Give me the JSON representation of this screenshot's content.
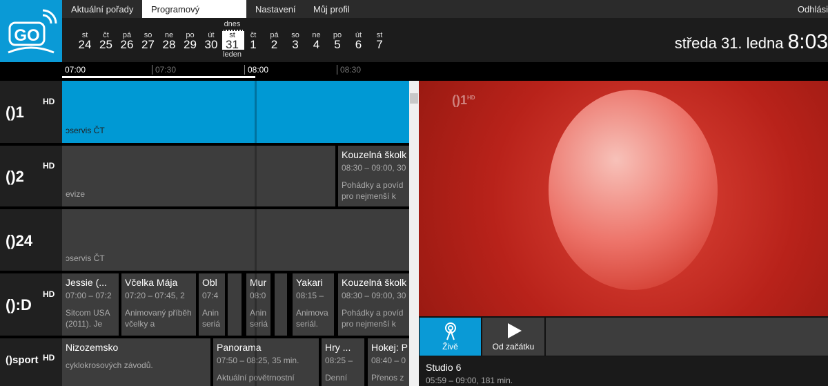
{
  "nav": {
    "tabs": [
      "Aktuální pořady",
      "Programový průvodce",
      "Nastavení",
      "Můj profil"
    ],
    "active": 1,
    "logout": "Odhlási"
  },
  "logo": "GO",
  "dates": [
    {
      "d": "st",
      "n": "24"
    },
    {
      "d": "čt",
      "n": "25"
    },
    {
      "d": "pá",
      "n": "26"
    },
    {
      "d": "so",
      "n": "27"
    },
    {
      "d": "ne",
      "n": "28"
    },
    {
      "d": "po",
      "n": "29"
    },
    {
      "d": "út",
      "n": "30"
    },
    {
      "d": "st",
      "n": "31",
      "top": "dnes",
      "bot": "leden"
    },
    {
      "d": "čt",
      "n": "1"
    },
    {
      "d": "pá",
      "n": "2"
    },
    {
      "d": "so",
      "n": "3"
    },
    {
      "d": "ne",
      "n": "4"
    },
    {
      "d": "po",
      "n": "5"
    },
    {
      "d": "út",
      "n": "6"
    },
    {
      "d": "st",
      "n": "7"
    }
  ],
  "now": {
    "date": "středa 31. ledna",
    "time": "8:03"
  },
  "timeline": [
    "07:00",
    "07:30",
    "08:00",
    "08:30"
  ],
  "channels": [
    {
      "name": "()1",
      "sup": "HD"
    },
    {
      "name": "()2",
      "sup": "HD"
    },
    {
      "name": "()24",
      "sup": ""
    },
    {
      "name": "():D",
      "sup": "HD"
    },
    {
      "name": "()sport",
      "sup": "HD"
    }
  ],
  "rows": [
    [
      {
        "t": "",
        "tm": "",
        "d": "ɔservis ČT"
      }
    ],
    [
      {
        "t": "",
        "tm": "",
        "d": "evize"
      },
      {
        "t": "Kouzelná školk",
        "tm": "08:30 – 09:00, 30",
        "d": "Pohádky a povíd pro nejmenší k"
      }
    ],
    [
      {
        "t": "",
        "tm": "",
        "d": "ɔservis ČT"
      }
    ],
    [
      {
        "t": "Jessie (...",
        "tm": "07:00 – 07:2",
        "d": "Sitcom USA (2011). Je"
      },
      {
        "t": "Včelka Mája",
        "tm": "07:20 – 07:45, 2",
        "d": "Animovaný příběh včelky a"
      },
      {
        "t": "Obl",
        "tm": "07:4",
        "d": "Anin seriá"
      },
      {
        "t": "",
        "tm": "",
        "d": ""
      },
      {
        "t": "Mur",
        "tm": "08:0",
        "d": "Anin seriá"
      },
      {
        "t": "",
        "tm": "",
        "d": ""
      },
      {
        "t": "Yakari",
        "tm": "08:15 –",
        "d": "Animova seriál."
      },
      {
        "t": "Kouzelná školk",
        "tm": "08:30 – 09:00, 30",
        "d": "Pohádky a povíd pro nejmenší k"
      }
    ],
    [
      {
        "t": "Nizozemsko",
        "tm": "",
        "d": "cyklokrosových závodů."
      },
      {
        "t": "Panorama",
        "tm": "07:50 – 08:25, 35 min.",
        "d": "Aktuální povětrnostní"
      },
      {
        "t": "Hry ...",
        "tm": "08:25 –",
        "d": "Denní"
      },
      {
        "t": "Hokej: P",
        "tm": "08:40 – 0",
        "d": "Přenos z"
      }
    ]
  ],
  "player": {
    "live": "Živě",
    "restart": "Od začátku",
    "title": "Studio 6",
    "time": "05:59 – 09:00, 181 min.",
    "channel_logo": "()1 HD"
  }
}
